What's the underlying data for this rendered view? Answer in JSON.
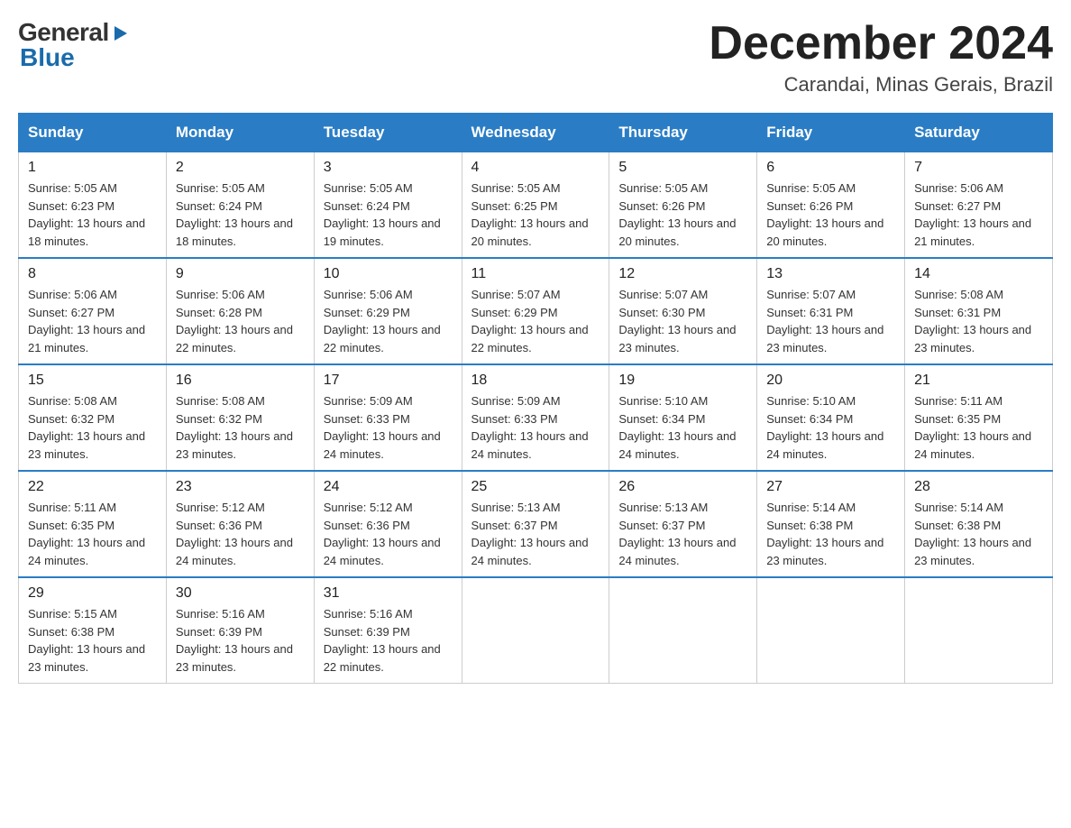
{
  "header": {
    "logo": {
      "general": "General",
      "blue": "Blue"
    },
    "title": "December 2024",
    "location": "Carandai, Minas Gerais, Brazil"
  },
  "calendar": {
    "days_of_week": [
      "Sunday",
      "Monday",
      "Tuesday",
      "Wednesday",
      "Thursday",
      "Friday",
      "Saturday"
    ],
    "weeks": [
      [
        {
          "day": "1",
          "sunrise": "5:05 AM",
          "sunset": "6:23 PM",
          "daylight": "13 hours and 18 minutes."
        },
        {
          "day": "2",
          "sunrise": "5:05 AM",
          "sunset": "6:24 PM",
          "daylight": "13 hours and 18 minutes."
        },
        {
          "day": "3",
          "sunrise": "5:05 AM",
          "sunset": "6:24 PM",
          "daylight": "13 hours and 19 minutes."
        },
        {
          "day": "4",
          "sunrise": "5:05 AM",
          "sunset": "6:25 PM",
          "daylight": "13 hours and 20 minutes."
        },
        {
          "day": "5",
          "sunrise": "5:05 AM",
          "sunset": "6:26 PM",
          "daylight": "13 hours and 20 minutes."
        },
        {
          "day": "6",
          "sunrise": "5:05 AM",
          "sunset": "6:26 PM",
          "daylight": "13 hours and 20 minutes."
        },
        {
          "day": "7",
          "sunrise": "5:06 AM",
          "sunset": "6:27 PM",
          "daylight": "13 hours and 21 minutes."
        }
      ],
      [
        {
          "day": "8",
          "sunrise": "5:06 AM",
          "sunset": "6:27 PM",
          "daylight": "13 hours and 21 minutes."
        },
        {
          "day": "9",
          "sunrise": "5:06 AM",
          "sunset": "6:28 PM",
          "daylight": "13 hours and 22 minutes."
        },
        {
          "day": "10",
          "sunrise": "5:06 AM",
          "sunset": "6:29 PM",
          "daylight": "13 hours and 22 minutes."
        },
        {
          "day": "11",
          "sunrise": "5:07 AM",
          "sunset": "6:29 PM",
          "daylight": "13 hours and 22 minutes."
        },
        {
          "day": "12",
          "sunrise": "5:07 AM",
          "sunset": "6:30 PM",
          "daylight": "13 hours and 23 minutes."
        },
        {
          "day": "13",
          "sunrise": "5:07 AM",
          "sunset": "6:31 PM",
          "daylight": "13 hours and 23 minutes."
        },
        {
          "day": "14",
          "sunrise": "5:08 AM",
          "sunset": "6:31 PM",
          "daylight": "13 hours and 23 minutes."
        }
      ],
      [
        {
          "day": "15",
          "sunrise": "5:08 AM",
          "sunset": "6:32 PM",
          "daylight": "13 hours and 23 minutes."
        },
        {
          "day": "16",
          "sunrise": "5:08 AM",
          "sunset": "6:32 PM",
          "daylight": "13 hours and 23 minutes."
        },
        {
          "day": "17",
          "sunrise": "5:09 AM",
          "sunset": "6:33 PM",
          "daylight": "13 hours and 24 minutes."
        },
        {
          "day": "18",
          "sunrise": "5:09 AM",
          "sunset": "6:33 PM",
          "daylight": "13 hours and 24 minutes."
        },
        {
          "day": "19",
          "sunrise": "5:10 AM",
          "sunset": "6:34 PM",
          "daylight": "13 hours and 24 minutes."
        },
        {
          "day": "20",
          "sunrise": "5:10 AM",
          "sunset": "6:34 PM",
          "daylight": "13 hours and 24 minutes."
        },
        {
          "day": "21",
          "sunrise": "5:11 AM",
          "sunset": "6:35 PM",
          "daylight": "13 hours and 24 minutes."
        }
      ],
      [
        {
          "day": "22",
          "sunrise": "5:11 AM",
          "sunset": "6:35 PM",
          "daylight": "13 hours and 24 minutes."
        },
        {
          "day": "23",
          "sunrise": "5:12 AM",
          "sunset": "6:36 PM",
          "daylight": "13 hours and 24 minutes."
        },
        {
          "day": "24",
          "sunrise": "5:12 AM",
          "sunset": "6:36 PM",
          "daylight": "13 hours and 24 minutes."
        },
        {
          "day": "25",
          "sunrise": "5:13 AM",
          "sunset": "6:37 PM",
          "daylight": "13 hours and 24 minutes."
        },
        {
          "day": "26",
          "sunrise": "5:13 AM",
          "sunset": "6:37 PM",
          "daylight": "13 hours and 24 minutes."
        },
        {
          "day": "27",
          "sunrise": "5:14 AM",
          "sunset": "6:38 PM",
          "daylight": "13 hours and 23 minutes."
        },
        {
          "day": "28",
          "sunrise": "5:14 AM",
          "sunset": "6:38 PM",
          "daylight": "13 hours and 23 minutes."
        }
      ],
      [
        {
          "day": "29",
          "sunrise": "5:15 AM",
          "sunset": "6:38 PM",
          "daylight": "13 hours and 23 minutes."
        },
        {
          "day": "30",
          "sunrise": "5:16 AM",
          "sunset": "6:39 PM",
          "daylight": "13 hours and 23 minutes."
        },
        {
          "day": "31",
          "sunrise": "5:16 AM",
          "sunset": "6:39 PM",
          "daylight": "13 hours and 22 minutes."
        },
        null,
        null,
        null,
        null
      ]
    ]
  }
}
